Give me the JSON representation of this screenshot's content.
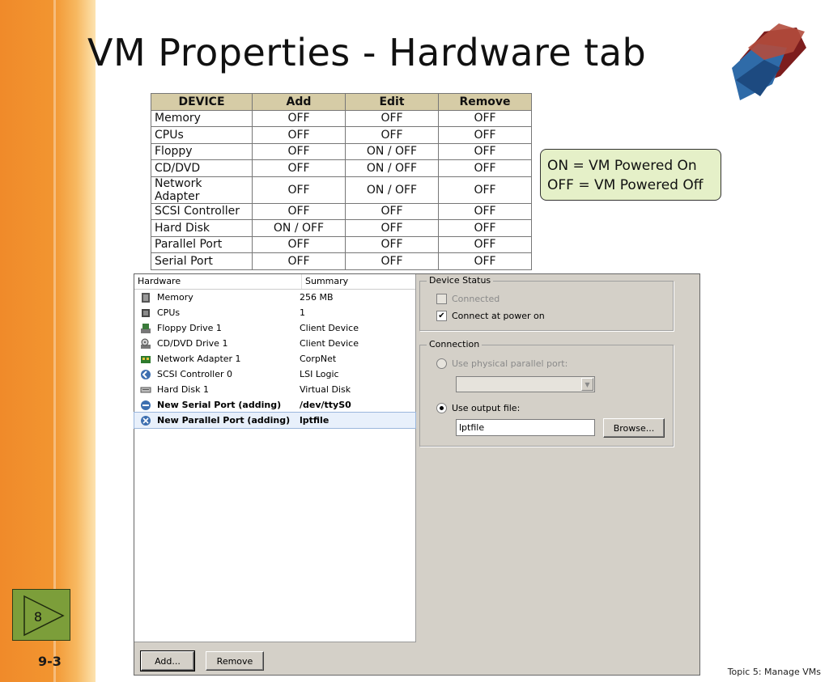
{
  "slide": {
    "title": "VM Properties - Hardware tab",
    "page_label": "9-3",
    "nav_number": "8",
    "footer": "Topic 5:  Manage VMs"
  },
  "matrix": {
    "headers": [
      "DEVICE",
      "Add",
      "Edit",
      "Remove"
    ],
    "rows": [
      [
        "Memory",
        "OFF",
        "OFF",
        "OFF"
      ],
      [
        "CPUs",
        "OFF",
        "OFF",
        "OFF"
      ],
      [
        "Floppy",
        "OFF",
        "ON / OFF",
        "OFF"
      ],
      [
        "CD/DVD",
        "OFF",
        "ON / OFF",
        "OFF"
      ],
      [
        "Network Adapter",
        "OFF",
        "ON / OFF",
        "OFF"
      ],
      [
        "SCSI Controller",
        "OFF",
        "OFF",
        "OFF"
      ],
      [
        "Hard Disk",
        "ON / OFF",
        "OFF",
        "OFF"
      ],
      [
        "Parallel Port",
        "OFF",
        "OFF",
        "OFF"
      ],
      [
        "Serial Port",
        "OFF",
        "OFF",
        "OFF"
      ]
    ]
  },
  "legend": {
    "line1": "ON = VM Powered On",
    "line2": "OFF = VM Powered Off"
  },
  "dialog": {
    "list_headers": {
      "hardware": "Hardware",
      "summary": "Summary"
    },
    "items": [
      {
        "name": "Memory",
        "summary": "256 MB",
        "icon": "memory-icon"
      },
      {
        "name": "CPUs",
        "summary": "1",
        "icon": "cpu-icon"
      },
      {
        "name": "Floppy Drive 1",
        "summary": "Client Device",
        "icon": "floppy-icon"
      },
      {
        "name": "CD/DVD Drive 1",
        "summary": "Client Device",
        "icon": "cd-dvd-icon"
      },
      {
        "name": "Network Adapter 1",
        "summary": "CorpNet",
        "icon": "network-adapter-icon"
      },
      {
        "name": "SCSI Controller 0",
        "summary": "LSI Logic",
        "icon": "scsi-controller-icon"
      },
      {
        "name": "Hard Disk 1",
        "summary": "Virtual Disk",
        "icon": "hard-disk-icon"
      },
      {
        "name": "New Serial Port (adding)",
        "summary": "/dev/ttyS0",
        "icon": "serial-port-icon"
      },
      {
        "name": "New Parallel Port (adding)",
        "summary": "lptfile",
        "icon": "parallel-port-icon"
      }
    ],
    "add_button": "Add...",
    "remove_button": "Remove",
    "device_status": {
      "legend": "Device Status",
      "connected": "Connected",
      "connected_checked": false,
      "connect_at_power_on": "Connect at power on",
      "connect_at_power_on_checked": true
    },
    "connection": {
      "legend": "Connection",
      "use_physical": "Use physical parallel port:",
      "use_output_file": "Use output file:",
      "output_file_value": "lptfile",
      "browse_button": "Browse..."
    }
  },
  "colors": {
    "orange_band": "#f29530",
    "table_header": "#d6cca6",
    "legend_box": "#e5f0c8",
    "nav_box": "#7c9e3a",
    "dialog_bg": "#d4d0c8"
  }
}
